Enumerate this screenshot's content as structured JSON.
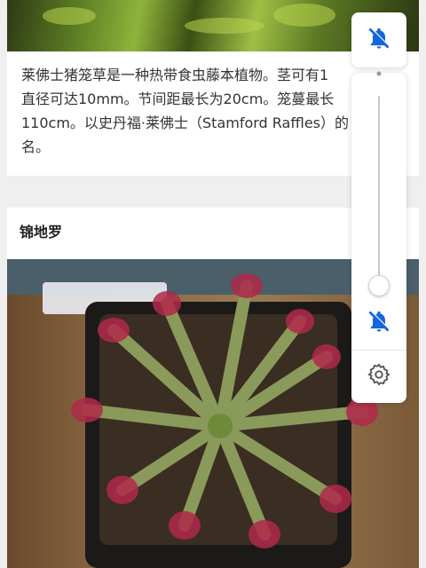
{
  "card1": {
    "description": "莱佛士猪笼草是一种热带食虫藤本植物。茎可有1\n直径可达10mm。节间距最长为20cm。笼蔓最长\n110cm。以史丹福·莱佛士（Stamford Raffles）的\n名。"
  },
  "card2": {
    "title": "锦地罗"
  },
  "volume_panel": {
    "ringer_icon": "bell-off-icon",
    "slider_icon": "bell-off-icon",
    "settings_icon": "gear-icon",
    "slider_level": 0,
    "accent_color": "#1565e0"
  }
}
